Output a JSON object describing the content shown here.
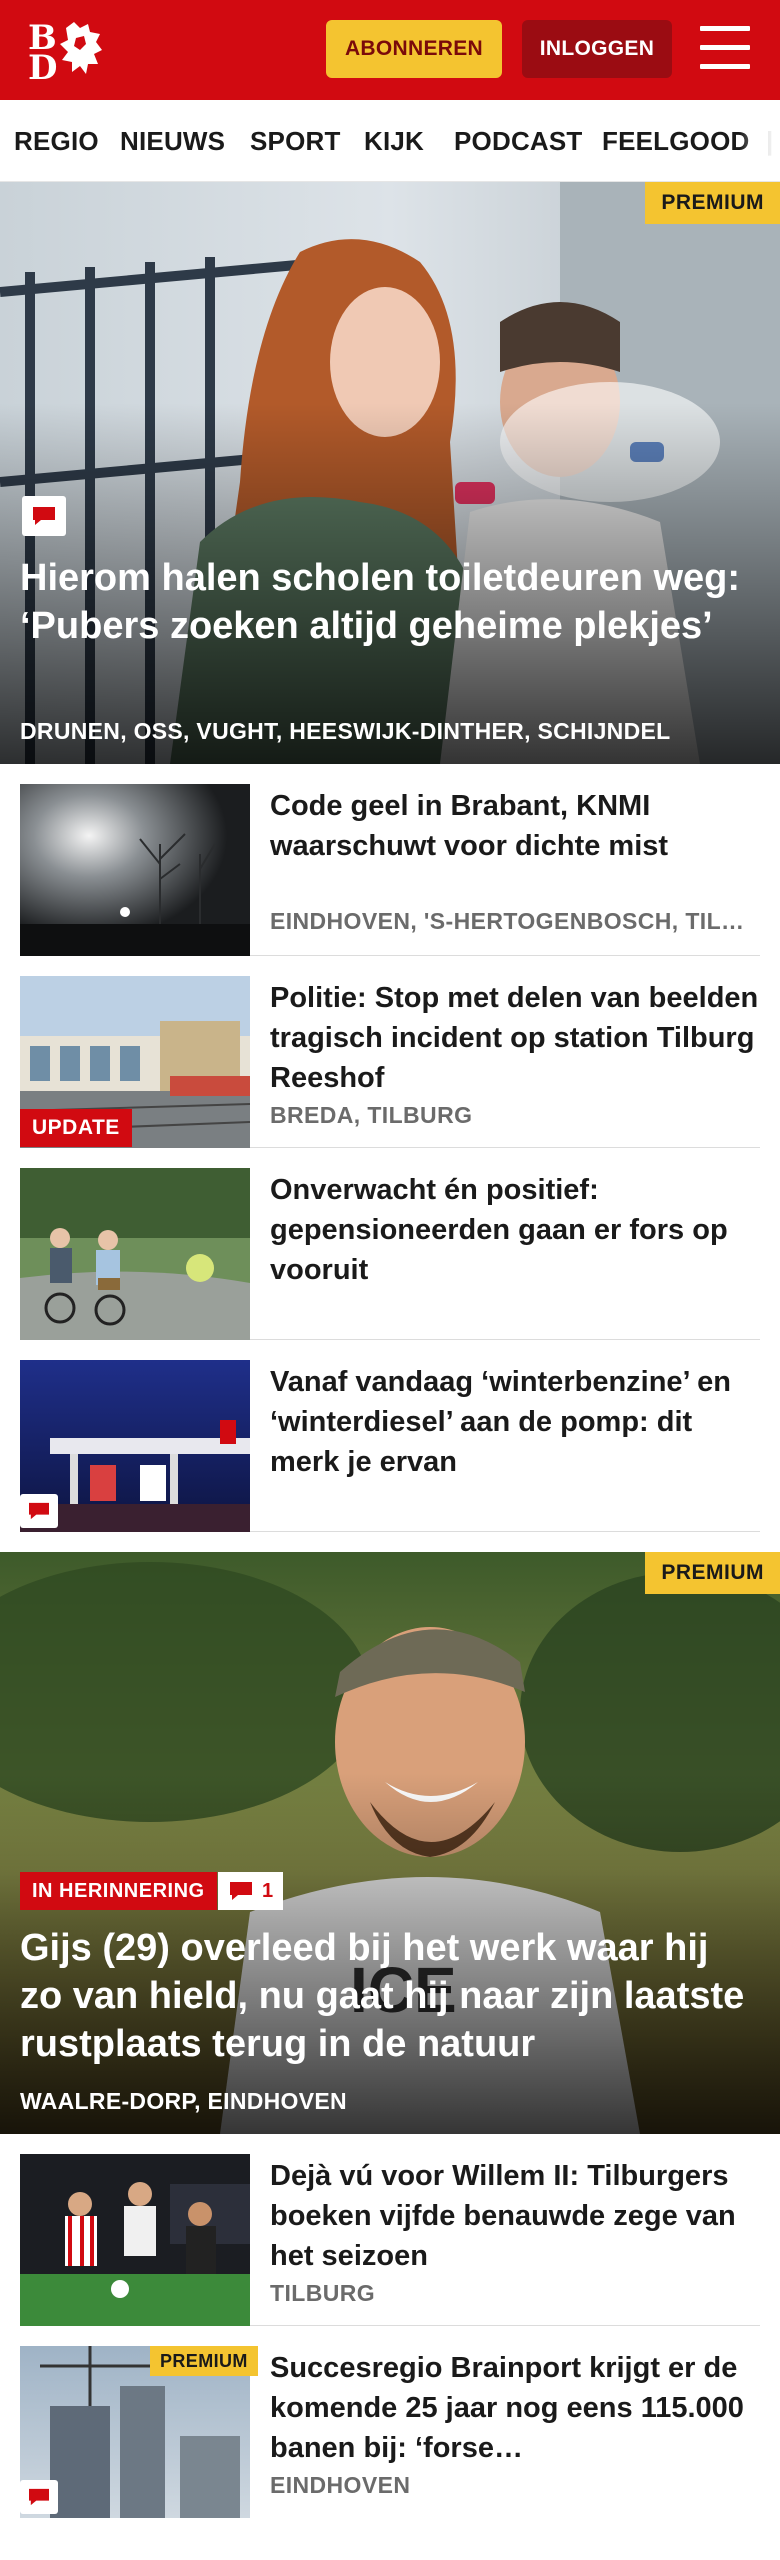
{
  "header": {
    "logo_text_top": "B",
    "logo_text_bottom": "D",
    "subscribe_label": "ABONNEREN",
    "login_label": "INLOGGEN",
    "brand_color": "#d10a11",
    "accent_color": "#f4c430",
    "menu_icon": "hamburger-icon"
  },
  "nav": {
    "items": [
      "REGIO",
      "NIEUWS",
      "SPORT",
      "KIJK",
      "PODCAST",
      "FEELGOOD"
    ]
  },
  "hero1": {
    "premium_label": "PREMIUM",
    "title": "Hierom halen scholen toiletdeuren weg: ‘Pubers zoeken altijd geheime plekjes’",
    "locations": "DRUNEN, OSS, VUGHT, HEESWIJK-DINTHER, SCHIJNDEL",
    "comment_icon": "comment-icon"
  },
  "articles1": [
    {
      "title": "Code geel in Brabant, KNMI waarschuwt voor dichte mist",
      "meta": "EINDHOVEN, 'S-HERTOGENBOSCH, TILBURG, BREDA"
    },
    {
      "title": "Politie: Stop met delen van beelden tragisch incident op station Tilburg Reeshof",
      "meta": "BREDA, TILBURG",
      "tag": "UPDATE"
    },
    {
      "title": "Onverwacht én positief: gepensioneerden gaan er fors op vooruit",
      "meta": ""
    },
    {
      "title": "Vanaf vandaag ‘winterbenzine’ en ‘winterdiesel’ aan de pomp: dit merk je ervan",
      "meta": ""
    }
  ],
  "hero2": {
    "premium_label": "PREMIUM",
    "tag": "IN HERINNERING",
    "comment_count": "1",
    "title": "Gijs (29) overleed bij het werk waar hij zo van hield, nu gaat hij naar zijn laatste rustplaats terug in de natuur",
    "locations": "WAALRE-DORP, EINDHOVEN"
  },
  "articles2": [
    {
      "title": "Dejà vú voor Willem II: Tilburgers boeken vijfde benauwde zege van het seizoen",
      "meta": "TILBURG"
    },
    {
      "title": "Succesregio Brainport krijgt er de komende 25 jaar nog eens 115.000 banen bij: ‘forse…",
      "meta": "EINDHOVEN",
      "premium_label": "PREMIUM"
    }
  ]
}
